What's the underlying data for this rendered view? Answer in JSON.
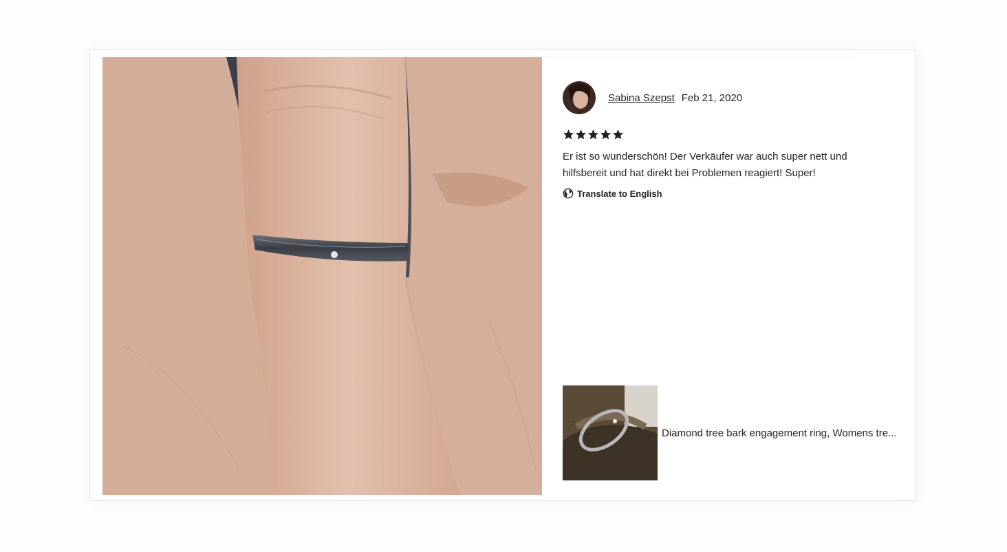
{
  "review": {
    "reviewer_name": "Sabina Szepst",
    "date": "Feb 21, 2020",
    "rating": 5,
    "text": "Er ist so wunderschön! Der Verkäufer war auch super nett und hilfsbereit und hat direkt bei Problemen reagiert! Super!",
    "translate_label": "Translate to English"
  },
  "listing": {
    "title": "Diamond tree bark engagement ring, Womens tre..."
  },
  "icons": {
    "star": "star-icon",
    "globe": "globe-icon"
  },
  "colors": {
    "text": "#222222",
    "star": "#222222",
    "border": "#e3e3e3"
  }
}
